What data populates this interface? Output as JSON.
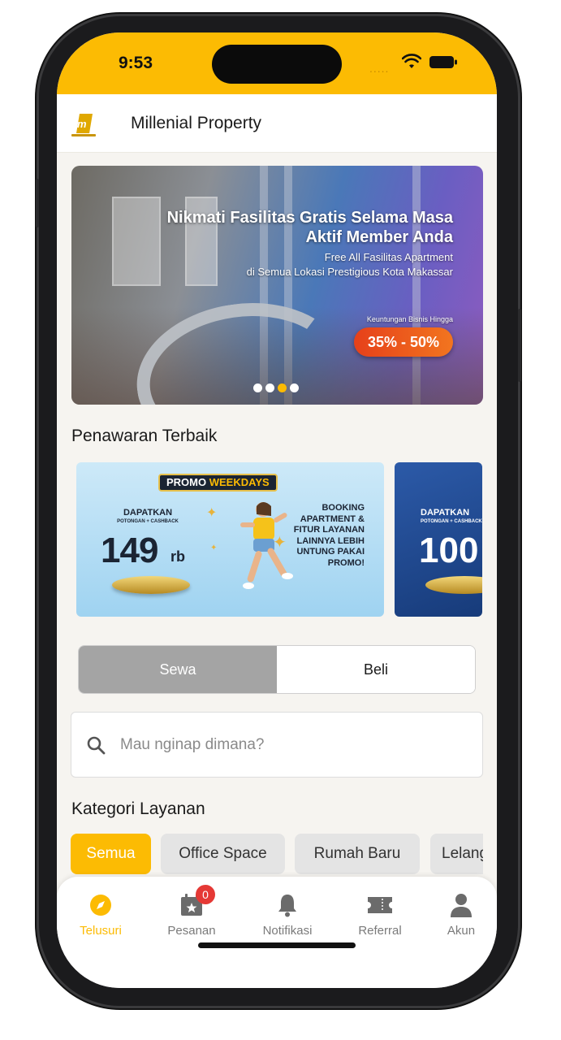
{
  "status_bar": {
    "time": "9:53",
    "signal_dots": "....."
  },
  "header": {
    "title": "Millenial Property"
  },
  "banner": {
    "title": "Nikmati Fasilitas Gratis Selama Masa Aktif Member Anda",
    "subtitle_line1": "Free All Fasilitas Apartment",
    "subtitle_line2": "di Semua Lokasi Prestigious Kota Makassar",
    "profit_label": "Keuntungan Bisnis Hingga",
    "profit_value": "35% - 50%",
    "slide_count": 4,
    "active_slide": 3
  },
  "offers": {
    "title": "Penawaran Terbaik",
    "cards": [
      {
        "tag_a": "PROMO ",
        "tag_b": "WEEKDAYS",
        "get": "DAPATKAN",
        "get_sub": "POTONGAN + CASHBACK",
        "price": "149",
        "price_unit": "rb",
        "text": "BOOKING APARTMENT & FITUR LAYANAN LAINNYA LEBIH UNTUNG PAKAI PROMO!"
      },
      {
        "get": "DAPATKAN",
        "get_sub": "POTONGAN + CASHBACK",
        "price": "100"
      }
    ]
  },
  "mode_toggle": {
    "rent": "Sewa",
    "buy": "Beli",
    "selected": "Sewa"
  },
  "search": {
    "placeholder": "Mau nginap dimana?",
    "value": ""
  },
  "categories": {
    "title": "Kategori Layanan",
    "items": [
      "Semua",
      "Office Space",
      "Rumah Baru",
      "Lelang"
    ],
    "selected": "Semua"
  },
  "tabbar": {
    "items": [
      {
        "label": "Telusuri",
        "icon": "compass-icon",
        "active": true
      },
      {
        "label": "Pesanan",
        "icon": "calendar-icon",
        "badge": "0"
      },
      {
        "label": "Notifikasi",
        "icon": "bell-icon"
      },
      {
        "label": "Referral",
        "icon": "ticket-icon"
      },
      {
        "label": "Akun",
        "icon": "user-icon"
      }
    ]
  },
  "colors": {
    "accent": "#fcbb03",
    "badge": "#e53935",
    "segment_active": "#a4a4a4"
  }
}
